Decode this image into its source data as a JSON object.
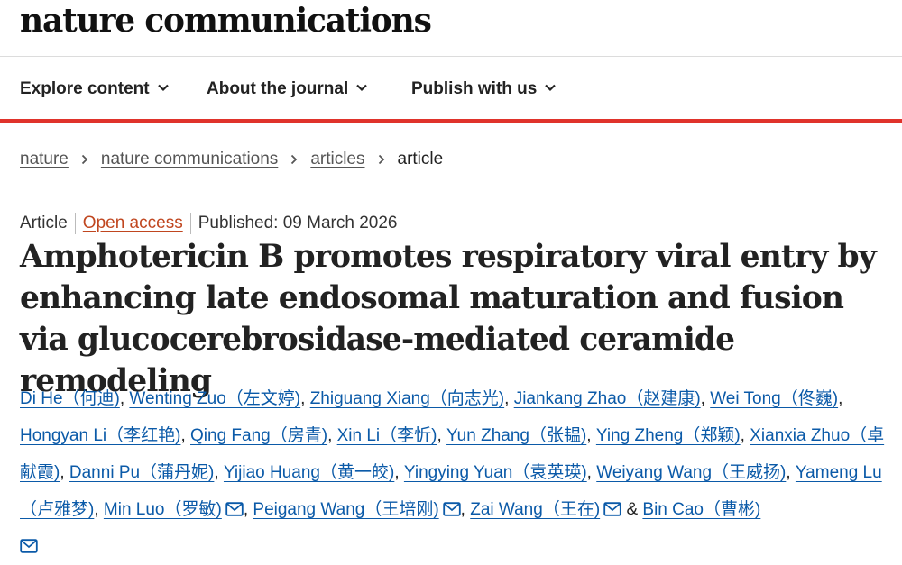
{
  "header": {
    "brand": "nature communications"
  },
  "nav": {
    "items": [
      {
        "label": "Explore content"
      },
      {
        "label": "About the journal"
      },
      {
        "label": "Publish with us"
      }
    ]
  },
  "breadcrumb": {
    "items": [
      "nature",
      "nature communications",
      "articles"
    ],
    "current": "article"
  },
  "article": {
    "type": "Article",
    "access": "Open access",
    "published": "Published: 09 March 2026",
    "title": "Amphotericin B promotes respiratory viral entry by enhancing late endosomal maturation and fusion via glucocerebrosidase-mediated ceramide remodeling",
    "authors": [
      {
        "name": "Di He（何迪)"
      },
      {
        "name": "Wenting Zuo（左文婷)"
      },
      {
        "name": "Zhiguang Xiang（向志光)"
      },
      {
        "name": "Jiankang Zhao（赵建康)"
      },
      {
        "name": "Wei Tong（佟巍)"
      },
      {
        "name": "Hongyan Li（李红艳)"
      },
      {
        "name": "Qing Fang（房青)"
      },
      {
        "name": "Xin Li（李忻)"
      },
      {
        "name": "Yun Zhang（张韫)"
      },
      {
        "name": "Ying Zheng（郑颖)"
      },
      {
        "name": "Xianxia Zhuo（卓献霞)"
      },
      {
        "name": "Danni Pu（蒲丹妮)"
      },
      {
        "name": "Yijiao Huang（黄一皎)"
      },
      {
        "name": "Yingying Yuan（袁英瑛)"
      },
      {
        "name": "Weiyang Wang（王威扬)"
      },
      {
        "name": "Yameng Lu（卢雅梦)"
      },
      {
        "name": "Min Luo（罗敏)"
      },
      {
        "name": "Peigang Wang（王培刚)"
      },
      {
        "name": "Zai Wang（王在)"
      },
      {
        "name": "Bin Cao（曹彬)"
      }
    ],
    "ampersand": "&"
  },
  "colors": {
    "accent_red": "#e0332b",
    "link_blue": "#0b5aa8",
    "open_access": "#c0461f"
  },
  "icons": {
    "nav_dropdown": "chevron-down-icon",
    "breadcrumb_sep": "chevron-right-icon",
    "corresponding_author": "mail-icon"
  }
}
